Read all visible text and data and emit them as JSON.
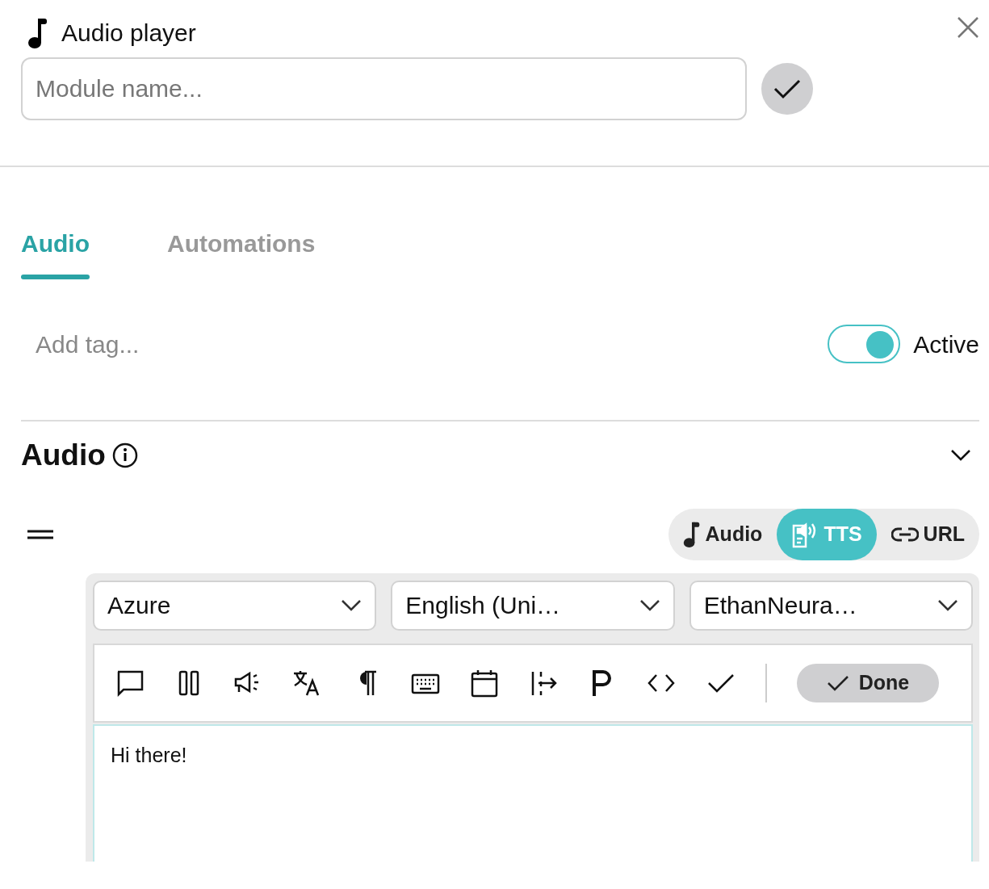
{
  "header": {
    "title": "Audio player",
    "name_field": {
      "placeholder": "Module name..."
    }
  },
  "tabs": [
    {
      "label": "Audio",
      "selected": true
    },
    {
      "label": "Automations",
      "selected": false
    }
  ],
  "tag_field": {
    "placeholder": "Add tag..."
  },
  "active_toggle": {
    "label": "Active",
    "on": true
  },
  "section": {
    "title": "Audio",
    "expanded": true
  },
  "source_switch": [
    {
      "kind": "audio",
      "label": "Audio",
      "selected": false
    },
    {
      "kind": "tts",
      "label": "TTS",
      "selected": true
    },
    {
      "kind": "url",
      "label": "URL",
      "selected": false
    }
  ],
  "selects": [
    {
      "value": "Azure"
    },
    {
      "value": "English (Uni…"
    },
    {
      "value": "EthanNeura…"
    }
  ],
  "toolbar": {
    "done_label": "Done"
  },
  "editor": {
    "text": "Hi there!"
  }
}
